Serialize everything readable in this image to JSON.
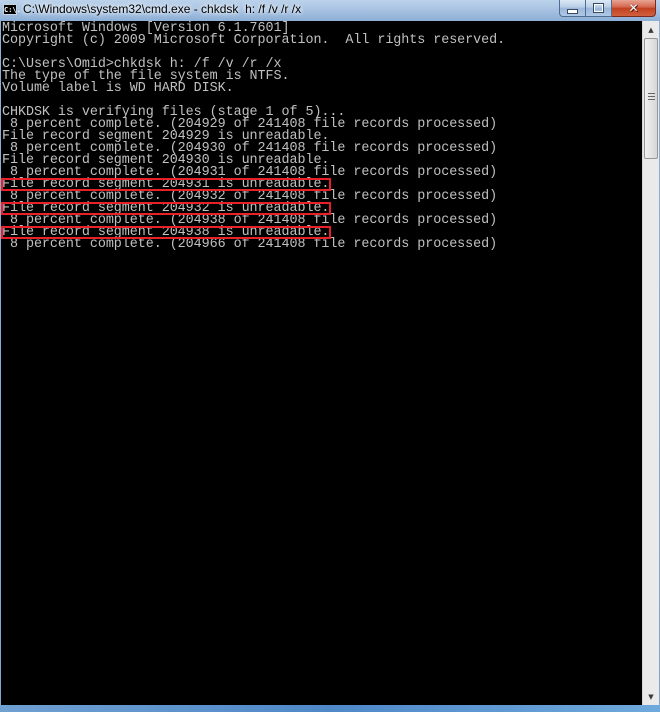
{
  "window": {
    "title": "C:\\Windows\\system32\\cmd.exe - chkdsk  h: /f /v /r /x",
    "app_icon_label": "C:\\.",
    "controls": {
      "minimize_icon": "minimize-icon",
      "maximize_icon": "restore-icon",
      "close_icon": "close-icon",
      "close_glyph": "✕"
    }
  },
  "console": {
    "lines": [
      "Microsoft Windows [Version 6.1.7601]",
      "Copyright (c) 2009 Microsoft Corporation.  All rights reserved.",
      "",
      "C:\\Users\\Omid>chkdsk h: /f /v /r /x",
      "The type of the file system is NTFS.",
      "Volume label is WD HARD DISK.",
      "",
      "CHKDSK is verifying files (stage 1 of 5)...",
      " 8 percent complete. (204929 of 241408 file records processed)",
      "File record segment 204929 is unreadable.",
      " 8 percent complete. (204930 of 241408 file records processed)",
      "File record segment 204930 is unreadable.",
      " 8 percent complete. (204931 of 241408 file records processed)",
      "File record segment 204931 is unreadable.",
      " 8 percent complete. (204932 of 241408 file records processed)",
      "File record segment 204932 is unreadable.",
      " 8 percent complete. (204938 of 241408 file records processed)",
      "File record segment 204938 is unreadable.",
      " 8 percent complete. (204966 of 241408 file records processed)"
    ],
    "highlighted_line_indices": [
      13,
      15,
      17
    ],
    "highlight_color": "#e8202a",
    "text_color": "#c0c0c0",
    "background_color": "#000000"
  },
  "scrollbar": {
    "up_arrow": "▲",
    "down_arrow": "▼"
  }
}
